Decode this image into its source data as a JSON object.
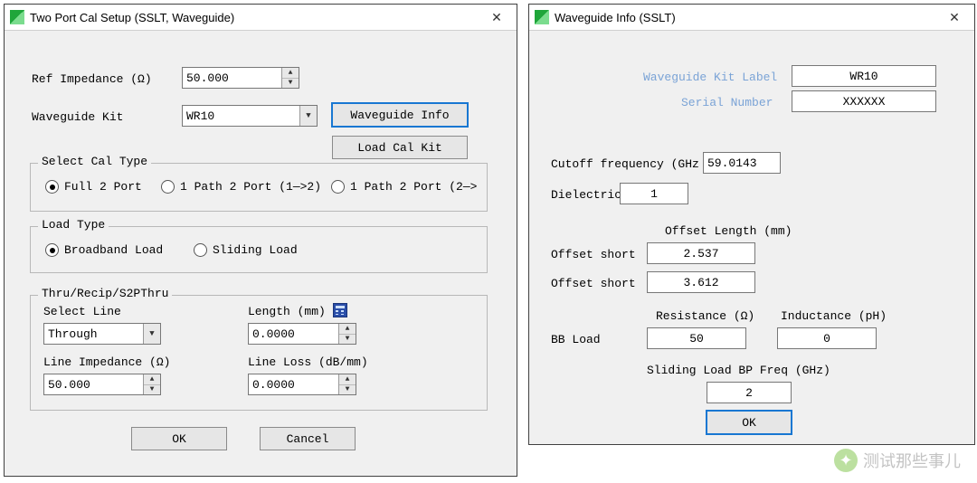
{
  "left": {
    "title": "Two Port Cal Setup (SSLT, Waveguide)",
    "ref_impedance_label": "Ref Impedance (Ω)",
    "ref_impedance_value": "50.000",
    "waveguide_kit_label": "Waveguide Kit",
    "waveguide_kit_value": "WR10",
    "waveguide_info_btn": "Waveguide Info",
    "load_cal_kit_btn": "Load Cal Kit",
    "select_cal_type_legend": "Select Cal Type",
    "cal_type": {
      "options": [
        "Full 2 Port",
        "1 Path 2 Port (1—>2)",
        "1 Path 2 Port (2—>"
      ],
      "selected_index": 0
    },
    "load_type_legend": "Load Type",
    "load_type": {
      "options": [
        "Broadband Load",
        "Sliding Load"
      ],
      "selected_index": 0
    },
    "thru_legend": "Thru/Recip/S2PThru",
    "select_line_label": "Select Line",
    "select_line_value": "Through",
    "length_label": "Length (mm)",
    "length_value": "0.0000",
    "line_impedance_label": "Line Impedance (Ω)",
    "line_impedance_value": "50.000",
    "line_loss_label": "Line Loss (dB/mm)",
    "line_loss_value": "0.0000",
    "ok_btn": "OK",
    "cancel_btn": "Cancel"
  },
  "right": {
    "title": "Waveguide Info (SSLT)",
    "kit_label_label": "Waveguide Kit Label",
    "kit_label_value": "WR10",
    "serial_label": "Serial Number",
    "serial_value": "XXXXXX",
    "cutoff_label": "Cutoff frequency (GHz",
    "cutoff_value": "59.0143",
    "dielectric_label": "Dielectric",
    "dielectric_value": "1",
    "offset_length_header": "Offset Length (mm)",
    "offset_short1_label": "Offset short",
    "offset_short1_value": "2.537",
    "offset_short2_label": "Offset short",
    "offset_short2_value": "3.612",
    "resistance_label": "Resistance (Ω)",
    "resistance_value": "50",
    "inductance_label": "Inductance (pH)",
    "inductance_value": "0",
    "bb_load_label": "BB Load",
    "sliding_bp_label": "Sliding Load BP Freq (GHz)",
    "sliding_bp_value": "2",
    "ok_btn": "OK"
  },
  "watermark": "测试那些事儿"
}
